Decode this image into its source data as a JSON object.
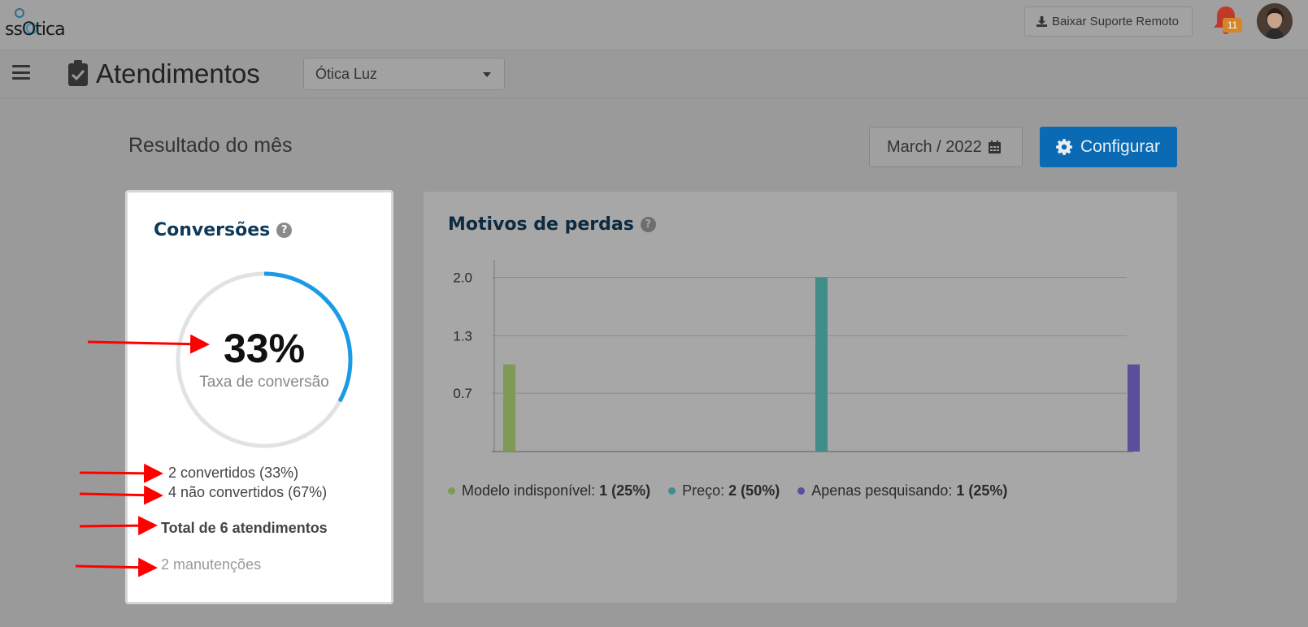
{
  "topbar": {
    "logo_text": "ssOtica",
    "remote_button_label": "Baixar Suporte Remoto",
    "notification_count": "11"
  },
  "header": {
    "title": "Atendimentos",
    "store_select_value": "Ótica Luz"
  },
  "section": {
    "title": "Resultado do mês",
    "date_value": "March / 2022",
    "config_label": "Configurar"
  },
  "conversions": {
    "title": "Conversões",
    "help": "?",
    "rate_percent": "33%",
    "rate_fraction": 0.33,
    "rate_label": "Taxa de conversão",
    "converted": "2 convertidos (33%)",
    "not_converted": "4 não convertidos (67%)",
    "total": "Total de 6 atendimentos",
    "maintenance": "2 manutenções"
  },
  "losses": {
    "title": "Motivos de perdas",
    "help": "?"
  },
  "chart_data": {
    "type": "bar",
    "title": "Motivos de perdas",
    "categories": [
      "Modelo indisponível",
      "Preço",
      "Apenas pesquisando"
    ],
    "values": [
      1,
      2,
      1
    ],
    "colors": [
      "#7f9a55",
      "#3f8e8a",
      "#5b4e9a"
    ],
    "ytick_labels": [
      "0.7",
      "1.3",
      "2.0"
    ],
    "yticks": [
      0.67,
      1.33,
      2.0
    ],
    "ylim": [
      0,
      2.2
    ],
    "grid": true,
    "legend": [
      {
        "label": "Modelo indisponível:",
        "value": "1 (25%)",
        "color": "#7f9a55"
      },
      {
        "label": "Preço:",
        "value": "2 (50%)",
        "color": "#3f8e8a"
      },
      {
        "label": "Apenas pesquisando:",
        "value": "1 (25%)",
        "color": "#5b4e9a"
      }
    ],
    "legend_position": "bottom-left"
  },
  "colors": {
    "primary": "#0a6ab3",
    "donut_progress": "#1a9be8",
    "donut_track": "#e2e2e2",
    "annotation_arrow": "#ff0000"
  }
}
